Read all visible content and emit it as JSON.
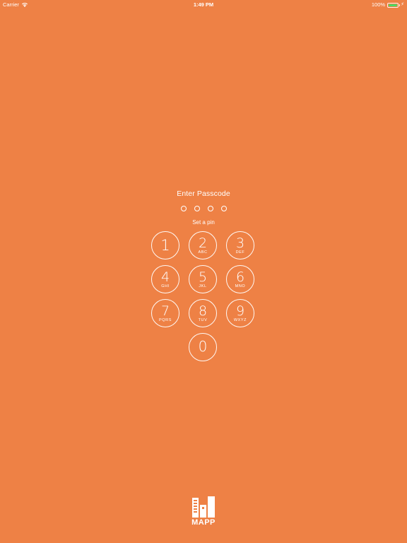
{
  "status_bar": {
    "carrier": "Carrier",
    "time": "1:49 PM",
    "battery": "100%",
    "battery_level": 1.0
  },
  "passcode": {
    "title": "Enter Passcode",
    "subtitle": "Set a pin",
    "dots": 4,
    "entered": 0
  },
  "keypad": {
    "keys": [
      {
        "digit": "1",
        "letters": ""
      },
      {
        "digit": "2",
        "letters": "ABC"
      },
      {
        "digit": "3",
        "letters": "DEF"
      },
      {
        "digit": "4",
        "letters": "GHI"
      },
      {
        "digit": "5",
        "letters": "JKL"
      },
      {
        "digit": "6",
        "letters": "MNO"
      },
      {
        "digit": "7",
        "letters": "PQRS"
      },
      {
        "digit": "8",
        "letters": "TUV"
      },
      {
        "digit": "9",
        "letters": "WXYZ"
      },
      {
        "digit": "0",
        "letters": ""
      }
    ]
  },
  "logo": {
    "text": "MAPP",
    "icon": "mapp-logo-icon"
  },
  "colors": {
    "background": "#EE8145",
    "foreground": "#FFFFFF",
    "battery": "#4CD964"
  }
}
